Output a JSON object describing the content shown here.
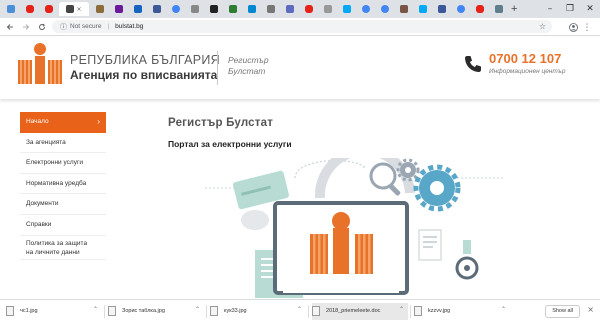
{
  "browser": {
    "tabs": [
      {
        "icon": "page-icon",
        "color": "#4a90d9"
      },
      {
        "icon": "youtube-icon",
        "color": "#e62117"
      },
      {
        "icon": "youtube-icon",
        "color": "#e62117"
      },
      {
        "icon": "page-icon",
        "color": "#444444",
        "active": true
      },
      {
        "icon": "page-icon",
        "color": "#8a6d3b"
      },
      {
        "icon": "page-icon",
        "color": "#6a1b9a"
      },
      {
        "icon": "page-icon",
        "color": "#1565c0"
      },
      {
        "icon": "facebook-icon",
        "color": "#3b5998"
      },
      {
        "icon": "google-icon",
        "color": "#4285f4"
      },
      {
        "icon": "page-icon",
        "color": "#888888"
      },
      {
        "icon": "page-icon",
        "color": "#222222"
      },
      {
        "icon": "page-icon",
        "color": "#2e7d32"
      },
      {
        "icon": "page-icon",
        "color": "#0288d1"
      },
      {
        "icon": "page-icon",
        "color": "#777777"
      },
      {
        "icon": "page-icon",
        "color": "#5c6bc0"
      },
      {
        "icon": "youtube-icon",
        "color": "#e62117"
      },
      {
        "icon": "page-icon",
        "color": "#999999"
      },
      {
        "icon": "page-icon",
        "color": "#03a9f4"
      },
      {
        "icon": "google-icon",
        "color": "#4285f4"
      },
      {
        "icon": "google-icon",
        "color": "#4285f4"
      },
      {
        "icon": "page-icon",
        "color": "#795548"
      },
      {
        "icon": "page-icon",
        "color": "#03a9f4"
      },
      {
        "icon": "facebook-icon",
        "color": "#3b5998"
      },
      {
        "icon": "google-icon",
        "color": "#4285f4"
      },
      {
        "icon": "youtube-icon",
        "color": "#e62117"
      },
      {
        "icon": "page-icon",
        "color": "#607d8b"
      }
    ],
    "active_tab_close": "×",
    "new_tab": "+",
    "window_controls": [
      "–",
      "❐",
      "✕"
    ],
    "address": {
      "security_label": "Not secure",
      "separator": "|",
      "url": "bulstat.bg"
    }
  },
  "header": {
    "brand_line1": "РЕПУБЛИКА БЪЛГАРИЯ",
    "brand_line2": "Агенция по вписванията",
    "register_line1": "Регистър",
    "register_line2": "Булстат",
    "phone_number": "0700 12 107",
    "phone_label": "Информационен център",
    "accent_color": "#e8722a"
  },
  "sidebar": {
    "items": [
      {
        "label": "Начало",
        "active": true
      },
      {
        "label": "За агенцията"
      },
      {
        "label": "Електронни услуги"
      },
      {
        "label": "Нормативна уредба"
      },
      {
        "label": "Документи"
      },
      {
        "label": "Справки"
      },
      {
        "label_line1": "Политика за защита",
        "label_line2": "на личните данни"
      }
    ],
    "active_chevron": "›"
  },
  "main": {
    "title": "Регистър Булстат",
    "subtitle": "Портал за електронни услуги"
  },
  "downloads": {
    "items": [
      {
        "name": "чс1.jpg"
      },
      {
        "name": "Зорис таблка.jpg"
      },
      {
        "name": "кук33.jpg"
      },
      {
        "name": "2018_priemeleete.doc",
        "highlight": true
      },
      {
        "name": "kzzvv.jpg"
      }
    ],
    "show_all": "Show all",
    "close": "×"
  }
}
